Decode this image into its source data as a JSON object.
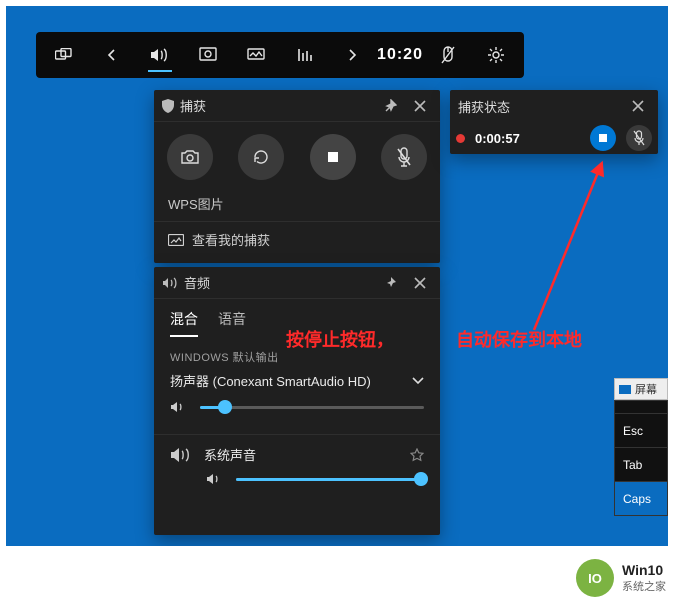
{
  "gamebar": {
    "time": "10:20"
  },
  "capture": {
    "title": "捕获",
    "app_label": "WPS图片",
    "view_link": "查看我的捕获"
  },
  "status": {
    "title": "捕获状态",
    "elapsed": "0:00:57"
  },
  "audio": {
    "title": "音频",
    "tab_mix": "混合",
    "tab_voice": "语音",
    "default_label": "WINDOWS 默认输出",
    "device": "扬声器 (Conexant SmartAudio HD)",
    "system_sound": "系统声音"
  },
  "annotations": {
    "press_stop": "按停止按钮，",
    "auto_save": "自动保存到本地"
  },
  "snippet": {
    "title": "屏幕",
    "esc": "Esc",
    "tab": "Tab",
    "caps": "Caps"
  },
  "brand": {
    "line1": "Win10",
    "line2": "系统之家"
  }
}
